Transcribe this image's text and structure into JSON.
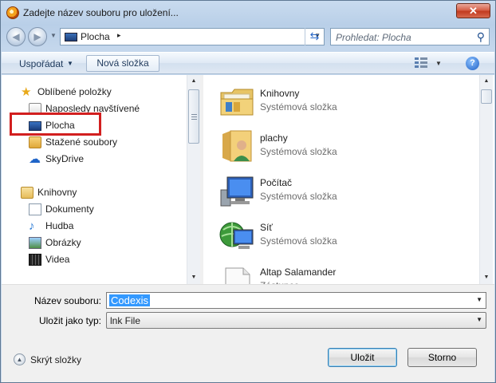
{
  "window": {
    "title": "Zadejte název souboru pro uložení...",
    "close_label": "✕"
  },
  "address": {
    "location": "Plocha",
    "separator": "▸"
  },
  "search": {
    "placeholder": "Prohledat: Plocha"
  },
  "toolbar": {
    "organize_label": "Uspořádat",
    "new_folder_label": "Nová složka",
    "help_label": "?"
  },
  "nav": {
    "favorites": [
      {
        "label": "Oblíbené položky",
        "icon": "star-icon"
      },
      {
        "label": "Naposledy navštívené",
        "icon": "recent-places-icon"
      },
      {
        "label": "Plocha",
        "icon": "desktop-icon"
      },
      {
        "label": "Stažené soubory",
        "icon": "downloads-icon"
      },
      {
        "label": "SkyDrive",
        "icon": "skydrive-icon"
      }
    ],
    "libraries": [
      {
        "label": "Knihovny",
        "icon": "libraries-icon"
      },
      {
        "label": "Dokumenty",
        "icon": "documents-icon"
      },
      {
        "label": "Hudba",
        "icon": "music-icon"
      },
      {
        "label": "Obrázky",
        "icon": "pictures-icon"
      },
      {
        "label": "Videa",
        "icon": "videos-icon"
      }
    ]
  },
  "files": [
    {
      "name": "Knihovny",
      "type": "Systémová složka",
      "icon": "libraries-folder-icon"
    },
    {
      "name": "plachy",
      "type": "Systémová složka",
      "icon": "user-folder-icon"
    },
    {
      "name": "Počítač",
      "type": "Systémová složka",
      "icon": "computer-icon"
    },
    {
      "name": "Síť",
      "type": "Systémová složka",
      "icon": "network-icon"
    },
    {
      "name": "Altap Salamander",
      "type": "Zástupce",
      "icon": "shortcut-icon"
    }
  ],
  "form": {
    "filename_label": "Název souboru:",
    "filename_value": "Codexis",
    "filetype_label": "Uložit jako typ:",
    "filetype_value": "lnk File"
  },
  "footer": {
    "hide_folders_label": "Skrýt složky",
    "save_label": "Uložit",
    "cancel_label": "Storno"
  },
  "colors": {
    "highlight_box": "#d21f1f",
    "selection": "#3399ff",
    "title_close": "#c23b20"
  }
}
